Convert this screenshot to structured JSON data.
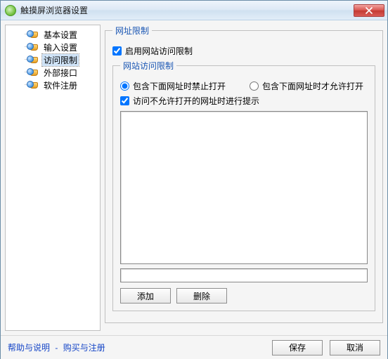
{
  "window": {
    "title": "触摸屏浏览器设置"
  },
  "sidebar": {
    "items": [
      {
        "label": "基本设置"
      },
      {
        "label": "输入设置"
      },
      {
        "label": "访问限制"
      },
      {
        "label": "外部接口"
      },
      {
        "label": "软件注册"
      }
    ],
    "selected_index": 2
  },
  "content": {
    "outer_legend": "网址限制",
    "enable_label": "启用网站访问限制",
    "enable_checked": true,
    "inner_legend": "网站访问限制",
    "radio_block_label": "包含下面网址时禁止打开",
    "radio_allow_label": "包含下面网址时才允许打开",
    "radio_selected": "block",
    "prompt_label": "访问不允许打开的网址时进行提示",
    "prompt_checked": true,
    "url_input_value": "",
    "add_button": "添加",
    "delete_button": "删除"
  },
  "footer": {
    "help_link": "帮助与说明",
    "buy_link": "购买与注册",
    "save_button": "保存",
    "cancel_button": "取消"
  }
}
